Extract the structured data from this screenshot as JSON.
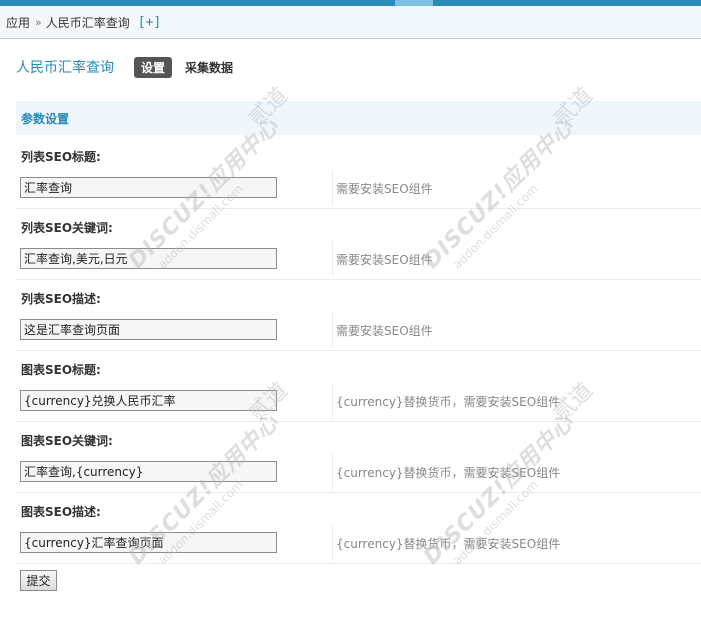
{
  "breadcrumb": {
    "root": "应用",
    "separator": "»",
    "current": "人民币汇率查询",
    "add_label": "[+]"
  },
  "header": {
    "title": "人民币汇率查询",
    "tabs": [
      {
        "label": "设置",
        "active": true
      },
      {
        "label": "采集数据",
        "active": false
      }
    ]
  },
  "section": {
    "title": "参数设置"
  },
  "fields": [
    {
      "label": "列表SEO标题:",
      "value": "汇率查询",
      "hint": "需要安装SEO组件"
    },
    {
      "label": "列表SEO关键词:",
      "value": "汇率查询,美元,日元",
      "hint": "需要安装SEO组件"
    },
    {
      "label": "列表SEO描述:",
      "value": "这是汇率查询页面",
      "hint": "需要安装SEO组件"
    },
    {
      "label": "图表SEO标题:",
      "value": "{currency}兑换人民币汇率",
      "hint": "{currency}替换货币，需要安装SEO组件"
    },
    {
      "label": "图表SEO关键词:",
      "value": "汇率查询,{currency}",
      "hint": "{currency}替换货币，需要安装SEO组件"
    },
    {
      "label": "图表SEO描述:",
      "value": "{currency}汇率查询页面",
      "hint": "{currency}替换货币，需要安装SEO组件"
    }
  ],
  "submit_label": "提交",
  "watermark": {
    "brand": "DISCUZ!应用中心",
    "domain": "addon.dismall.com",
    "mark": "贰道"
  },
  "colors": {
    "accent": "#2a8ab8",
    "topbar": "#2a8ab8",
    "section_bg": "#f0f7fc"
  }
}
